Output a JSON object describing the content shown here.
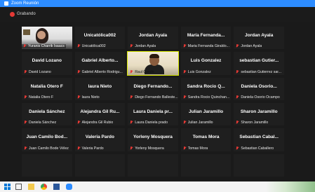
{
  "window": {
    "title": "Zoom Reunión"
  },
  "recording": {
    "label": "Grabando"
  },
  "participants": [
    {
      "big": "",
      "footer": "Yuranis Charrik Isaacs",
      "video": true
    },
    {
      "big": "Unicatólica002",
      "footer": "Unicatólica002"
    },
    {
      "big": "Jordan Ayala",
      "footer": "Jordan Ayala"
    },
    {
      "big": "María Fernanda...",
      "footer": "Maria Fernanda Giraldo..."
    },
    {
      "big": "Jordan Ayala",
      "footer": "Jordan Ayala"
    },
    {
      "big": "David Lozano",
      "footer": "David Lozano"
    },
    {
      "big": "Gabriel Alberto...",
      "footer": "Gabriel Alberto Rodrigu..."
    },
    {
      "big": "",
      "footer": "Raul Cando",
      "active": true
    },
    {
      "big": "Luis Gonzalez",
      "footer": "Luis Gonzalez"
    },
    {
      "big": "sebastian Gutier...",
      "footer": "sebastian Gutierrez sar..."
    },
    {
      "big": "Natalia Otero F",
      "footer": "Natalia Otero F"
    },
    {
      "big": "laura Nieto",
      "footer": "laura Nieto"
    },
    {
      "big": "Diego Fernando...",
      "footer": "Diego Fernando Balleste..."
    },
    {
      "big": "Sandra Rocio Q...",
      "footer": "Sandra Rocio Quinchan..."
    },
    {
      "big": "Daniela Osorio...",
      "footer": "Daniela Osorio Ocampo"
    },
    {
      "big": "Daniela Sánchez",
      "footer": "Daniela Sánchez"
    },
    {
      "big": "Alejandra Gil Ru...",
      "footer": "Alejandra Gil Rubio"
    },
    {
      "big": "Laura Daniela pr...",
      "footer": "Laura Daniela prado"
    },
    {
      "big": "Julian Jaramillo",
      "footer": "Julian Jaramillo"
    },
    {
      "big": "Sharon Jaramillo",
      "footer": "Sharon Jaramillo"
    },
    {
      "big": "Juan Camilo Bod...",
      "footer": "Juan Camilo Bode Vélez"
    },
    {
      "big": "Valeria Pardo",
      "footer": "Valeria Pardo"
    },
    {
      "big": "Yorleny Mosquera",
      "footer": "Yorleny Mosquera"
    },
    {
      "big": "Tomas Mora",
      "footer": "Tomas Mora"
    },
    {
      "big": "Sebastian Cabal...",
      "footer": "Sebastian Caballero"
    },
    {
      "big": "",
      "footer": ""
    },
    {
      "big": "",
      "footer": ""
    },
    {
      "big": "",
      "footer": ""
    },
    {
      "big": "",
      "footer": ""
    },
    {
      "big": "",
      "footer": ""
    }
  ],
  "colors": {
    "accent": "#2d8cff",
    "speaker": "#d7e600",
    "muted": "#e53935"
  },
  "taskbar": {
    "icons": [
      "windows-start-icon",
      "task-view-icon",
      "file-explorer-icon",
      "chrome-icon",
      "word-icon",
      "zoom-icon"
    ]
  }
}
